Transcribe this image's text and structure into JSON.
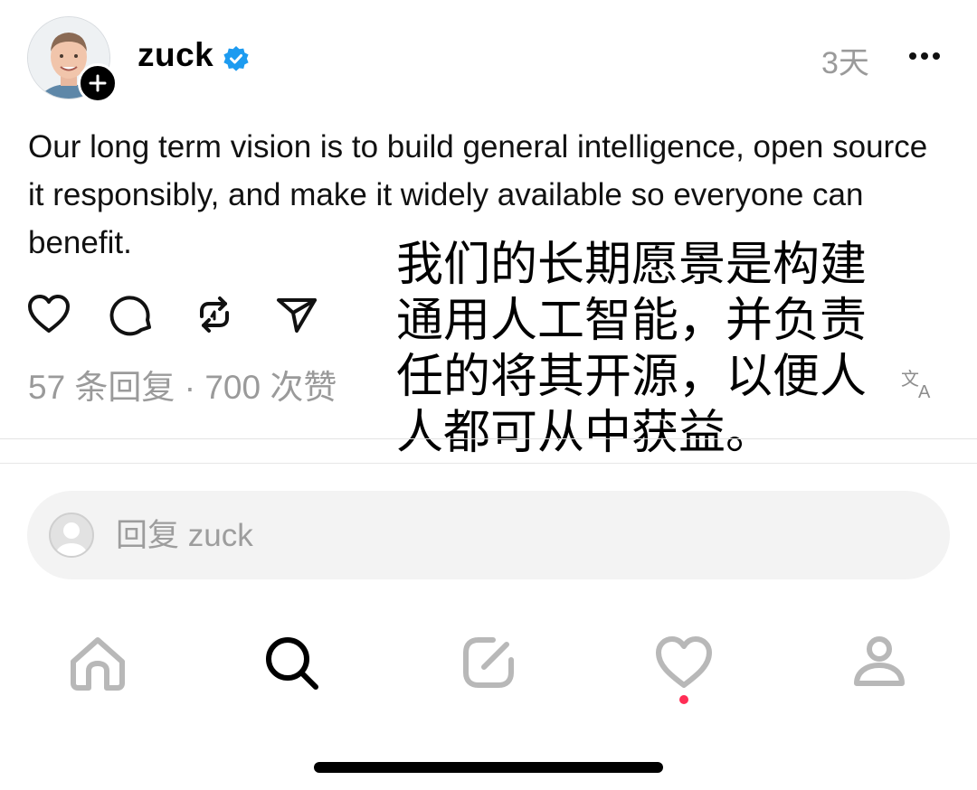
{
  "post": {
    "username": "zuck",
    "time": "3天",
    "text": "Our long term vision is to build general intelligence, open source it responsibly, and make it widely available so everyone can benefit.",
    "stats": "57 条回复 · 700 次赞"
  },
  "translation_overlay": {
    "lines": [
      "我们的长期愿景是构建",
      "通用人工智能，并负责",
      "任的将其开源，以便人",
      "人都可从中获益。"
    ]
  },
  "reply": {
    "placeholder": "回复 zuck"
  },
  "colors": {
    "verified": "#1d9bf0",
    "muted_text": "#9a9a9a",
    "notification_dot": "#ff2d55",
    "nav_inactive": "#b8b8b8"
  },
  "icons": {
    "actions": [
      "heart-icon",
      "comment-icon",
      "repost-icon",
      "share-icon"
    ],
    "nav": [
      "home-icon",
      "search-icon",
      "compose-icon",
      "activity-heart-icon",
      "profile-icon"
    ]
  }
}
